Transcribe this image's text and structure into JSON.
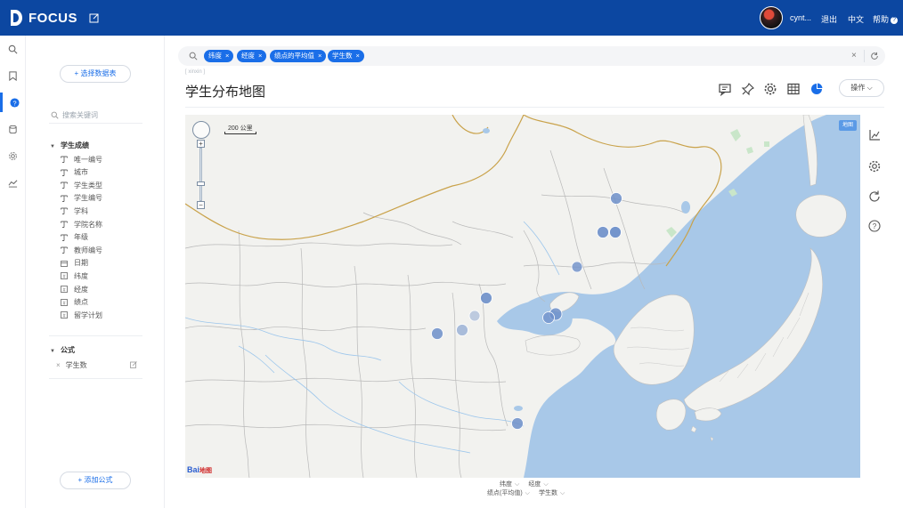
{
  "app": {
    "brand": "FOCUS",
    "user": "cynt...",
    "links": {
      "logout": "退出",
      "language": "中文",
      "help": "帮助"
    }
  },
  "rail": {
    "items": [
      "search-icon",
      "bookmark-icon",
      "question-icon",
      "database-icon",
      "gear-icon",
      "trend-icon"
    ],
    "active_index": 2
  },
  "panel": {
    "select_source": "选择数据表",
    "search_placeholder": "搜索关键词",
    "group1": {
      "label": "学生成绩",
      "fields": [
        {
          "icon": "text-field-icon",
          "label": "唯一编号"
        },
        {
          "icon": "text-field-icon",
          "label": "城市"
        },
        {
          "icon": "text-field-icon",
          "label": "学生类型"
        },
        {
          "icon": "text-field-icon",
          "label": "学生编号"
        },
        {
          "icon": "text-field-icon",
          "label": "学科"
        },
        {
          "icon": "text-field-icon",
          "label": "学院名称"
        },
        {
          "icon": "text-field-icon",
          "label": "年级"
        },
        {
          "icon": "text-field-icon",
          "label": "教师编号"
        },
        {
          "icon": "calendar-icon",
          "label": "日期"
        },
        {
          "icon": "number-field-icon",
          "label": "纬度"
        },
        {
          "icon": "number-field-icon",
          "label": "经度"
        },
        {
          "icon": "number-field-icon",
          "label": "绩点"
        },
        {
          "icon": "number-field-icon",
          "label": "留学计划"
        }
      ]
    },
    "group2": {
      "label": "公式",
      "formulas": [
        {
          "label": "学生数"
        }
      ]
    },
    "add_formula": "添加公式"
  },
  "search": {
    "chips": [
      "纬度",
      "经度",
      "绩点的平均值",
      "学生数"
    ]
  },
  "report": {
    "subtitle": "[ xinxin ]",
    "title": "学生分布地图",
    "operations": "操作"
  },
  "map": {
    "scale": "200 公里",
    "type_button": "地图",
    "logo": {
      "left": "Bai",
      "right": "地图"
    },
    "accent_color": "#1a6ee8",
    "point_color": "#6d8fc9"
  },
  "encodings": {
    "row1": [
      {
        "label": "纬度"
      },
      {
        "label": "经度"
      }
    ],
    "row2": [
      {
        "label": "绩点(平均值)"
      },
      {
        "label": "学生数"
      }
    ]
  }
}
